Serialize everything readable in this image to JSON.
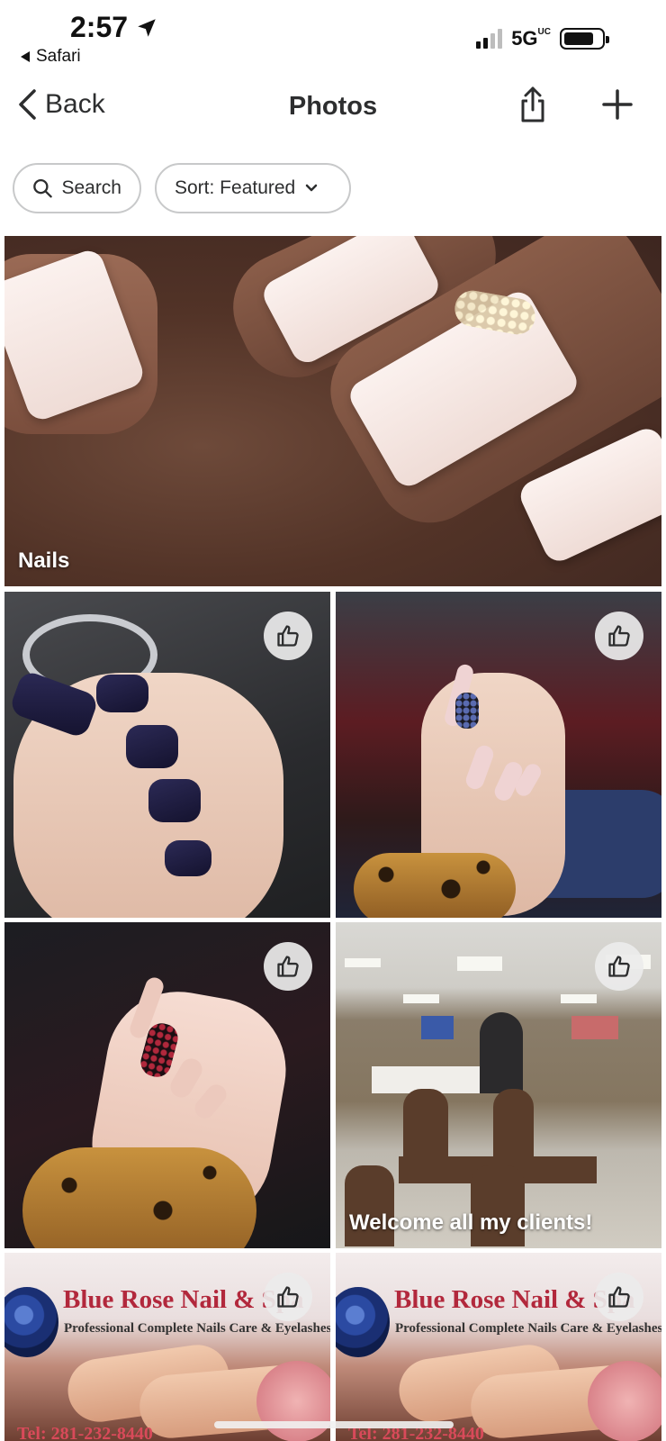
{
  "status_bar": {
    "time": "2:57",
    "back_app": "Safari",
    "network": "5G",
    "network_suffix": "UC"
  },
  "nav": {
    "back_label": "Back",
    "title": "Photos"
  },
  "filters": {
    "search_label": "Search",
    "sort_label": "Sort: Featured"
  },
  "photos": [
    {
      "caption": "Nails"
    },
    {
      "caption": ""
    },
    {
      "caption": ""
    },
    {
      "caption": ""
    },
    {
      "caption": "Welcome all my clients!"
    },
    {
      "caption": ""
    },
    {
      "caption": ""
    }
  ],
  "flyer": {
    "title": "Blue Rose  Nail & Spa",
    "subtitle": "Professional Complete Nails Care & Eyelashes",
    "tel": "Tel: 281-232-8440"
  },
  "icons": {
    "location": "location-arrow-icon",
    "back_chevron": "chevron-left-icon",
    "share": "share-icon",
    "add": "plus-icon",
    "search": "search-icon",
    "sort_caret": "chevron-down-icon",
    "like": "thumbs-up-icon"
  }
}
